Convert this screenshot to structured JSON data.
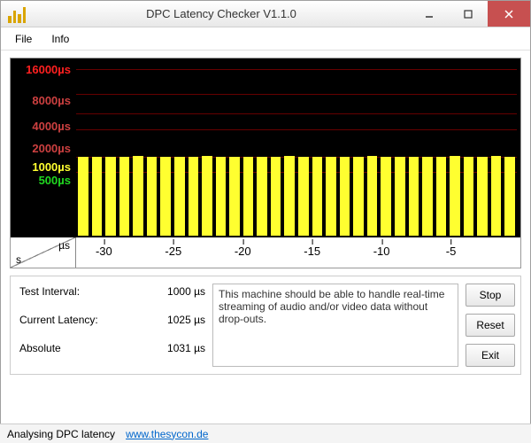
{
  "window": {
    "title": "DPC Latency Checker V1.1.0"
  },
  "menu": {
    "file": "File",
    "info": "Info"
  },
  "chart_data": {
    "type": "bar",
    "ylabel_unit": "µs",
    "xlabel_unit_top": "µs",
    "xlabel_unit_bottom": "s",
    "y_ticks": [
      500,
      1000,
      2000,
      4000,
      8000,
      16000
    ],
    "y_tick_labels": [
      "500µs",
      "1000µs",
      "2000µs",
      "4000µs",
      "8000µs",
      "16000µs"
    ],
    "x_ticks": [
      -30,
      -25,
      -20,
      -15,
      -10,
      -5
    ],
    "values": [
      1020,
      1010,
      1025,
      1015,
      1030,
      1020,
      1025,
      1015,
      1020,
      1030,
      1025,
      1020,
      1015,
      1025,
      1020,
      1030,
      1025,
      1020,
      1015,
      1025,
      1020,
      1030,
      1025,
      1020,
      1015,
      1025,
      1020,
      1030,
      1025,
      1020,
      1030,
      1025
    ],
    "ylim": [
      0,
      16000
    ],
    "title": ""
  },
  "stats": {
    "test_interval_label": "Test Interval:",
    "test_interval_value": "1000 µs",
    "current_latency_label": "Current Latency:",
    "current_latency_value": "1025 µs",
    "absolute_label": "Absolute",
    "absolute_value": "1031 µs"
  },
  "message": "This machine should be able to handle real-time streaming of audio and/or video data without drop-outs.",
  "buttons": {
    "stop": "Stop",
    "reset": "Reset",
    "exit": "Exit"
  },
  "status": {
    "text": "Analysing DPC latency",
    "link": "www.thesycon.de"
  }
}
